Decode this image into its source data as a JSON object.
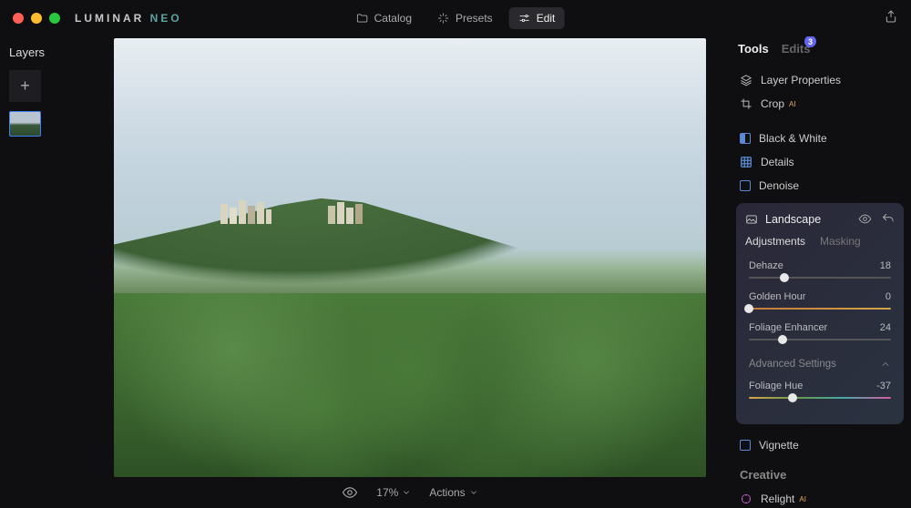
{
  "app": {
    "logo_a": "LUMINAR",
    "logo_b": " NEO"
  },
  "nav": {
    "catalog": "Catalog",
    "presets": "Presets",
    "edit": "Edit"
  },
  "layers": {
    "title": "Layers"
  },
  "bottom": {
    "zoom": "17%",
    "actions": "Actions"
  },
  "tabs": {
    "tools": "Tools",
    "edits": "Edits",
    "badge": "3"
  },
  "tools": {
    "layer_props": "Layer Properties",
    "crop": "Crop",
    "bw": "Black & White",
    "details": "Details",
    "denoise": "Denoise",
    "vignette": "Vignette",
    "creative": "Creative",
    "relight": "Relight"
  },
  "landscape": {
    "title": "Landscape",
    "tab_adj": "Adjustments",
    "tab_mask": "Masking",
    "dehaze": {
      "label": "Dehaze",
      "value": "18",
      "pos": 25
    },
    "golden": {
      "label": "Golden Hour",
      "value": "0",
      "pos": 0
    },
    "foliage": {
      "label": "Foliage Enhancer",
      "value": "24",
      "pos": 24
    },
    "adv": "Advanced Settings",
    "hue": {
      "label": "Foliage Hue",
      "value": "-37",
      "pos": 31
    }
  }
}
